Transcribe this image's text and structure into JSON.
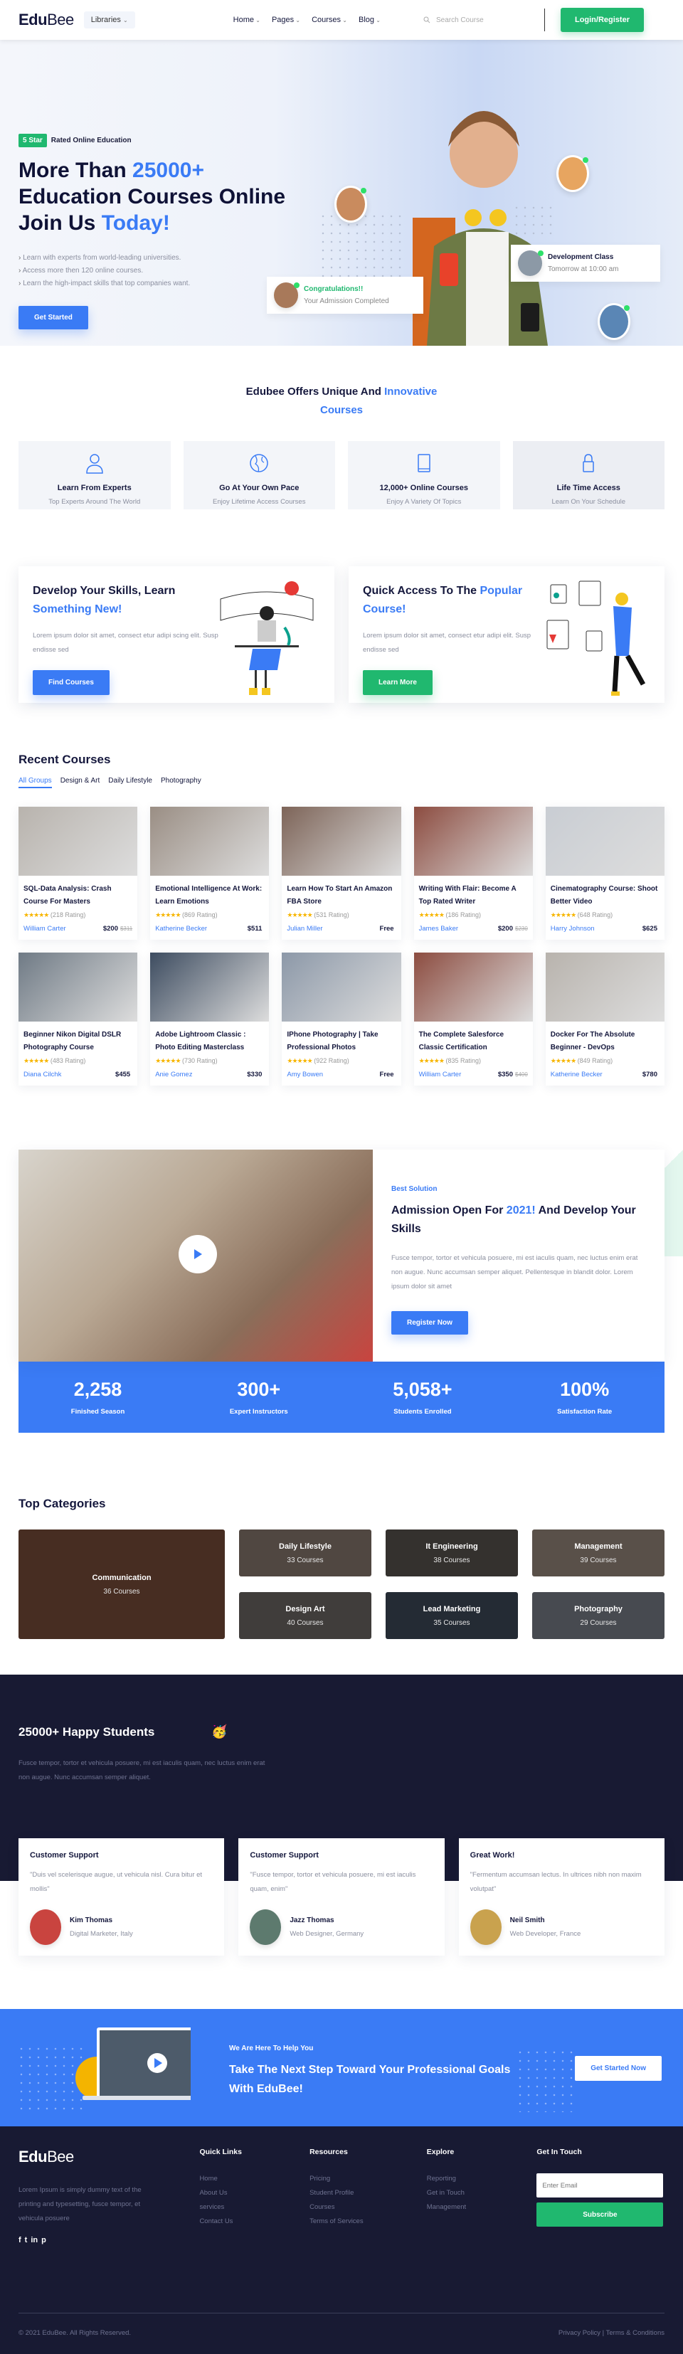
{
  "header": {
    "logo_bold": "Edu",
    "logo_light": "Bee",
    "libraries": "Libraries",
    "nav": [
      "Home",
      "Pages",
      "Courses",
      "Blog"
    ],
    "search_placeholder": "Search Course",
    "login": "Login/Register"
  },
  "hero": {
    "badge": "5 Star",
    "badge_text": "Rated Online Education",
    "title_a": "More Than ",
    "title_highlight": "25000+",
    "title_b": "Education Courses Online",
    "title_c": "Join Us ",
    "title_highlight2": "Today!",
    "bullets": [
      "Learn with experts from world-leading universities.",
      "Access more then 120 online courses.",
      "Learn the high-impact skills that top companies want."
    ],
    "cta": "Get Started",
    "notice1": {
      "title": "Congratulations!!",
      "sub": "Your Admission Completed"
    },
    "notice2": {
      "title": "Development Class",
      "sub": "Tomorrow at 10:00 am"
    }
  },
  "offers": {
    "title_a": "Edubee Offers Unique And ",
    "title_highlight": "Innovative",
    "title_b": "Courses",
    "features": [
      {
        "icon": "user-icon",
        "title": "Learn From Experts",
        "sub": "Top Experts Around The World"
      },
      {
        "icon": "globe-icon",
        "title": "Go At Your Own Pace",
        "sub": "Enjoy Lifetime Access Courses"
      },
      {
        "icon": "book-icon",
        "title": "12,000+ Online Courses",
        "sub": "Enjoy A Variety Of Topics"
      },
      {
        "icon": "lock-icon",
        "title": "Life Time Access",
        "sub": "Learn On Your Schedule"
      }
    ]
  },
  "skills": [
    {
      "title_a": "Develop Your Skills, Learn ",
      "title_highlight": "Something New!",
      "text": "Lorem ipsum dolor sit amet, consect etur adipi scing elit. Susp endisse sed",
      "button": "Find Courses",
      "color": "#3a7bf5"
    },
    {
      "title_a": "Quick Access To The ",
      "title_highlight": "Popular Course!",
      "text": "Lorem ipsum dolor sit amet, consect etur adipi elit. Susp endisse sed",
      "button": "Learn More",
      "color": "#20b86f"
    }
  ],
  "recent": {
    "title": "Recent Courses",
    "tabs": [
      "All Groups",
      "Design & Art",
      "Daily Lifestyle",
      "Photography"
    ],
    "courses": [
      {
        "title": "SQL-Data Analysis: Crash Course For Masters",
        "rating": "(218 Rating)",
        "instructor": "William Carter",
        "price": "$200",
        "old": "$311"
      },
      {
        "title": "Emotional Intelligence At Work: Learn Emotions",
        "rating": "(869 Rating)",
        "instructor": "Katherine Becker",
        "price": "$511",
        "old": ""
      },
      {
        "title": "Learn How To Start An Amazon FBA Store",
        "rating": "(531 Rating)",
        "instructor": "Julian Miller",
        "price": "Free",
        "old": ""
      },
      {
        "title": "Writing With Flair: Become A Top Rated Writer",
        "rating": "(186 Rating)",
        "instructor": "James Baker",
        "price": "$200",
        "old": "$230"
      },
      {
        "title": "Cinematography Course: Shoot Better Video",
        "rating": "(648 Rating)",
        "instructor": "Harry Johnson",
        "price": "$625",
        "old": ""
      },
      {
        "title": "Beginner Nikon Digital DSLR Photography Course",
        "rating": "(483 Rating)",
        "instructor": "Diana Cilchk",
        "price": "$455",
        "old": ""
      },
      {
        "title": "Adobe Lightroom Classic : Photo Editing Masterclass",
        "rating": "(730 Rating)",
        "instructor": "Anie Gomez",
        "price": "$330",
        "old": ""
      },
      {
        "title": "IPhone Photography | Take Professional Photos",
        "rating": "(922 Rating)",
        "instructor": "Amy Bowen",
        "price": "Free",
        "old": ""
      },
      {
        "title": "The Complete Salesforce Classic Certification",
        "rating": "(835 Rating)",
        "instructor": "William Carter",
        "price": "$350",
        "old": "$400"
      },
      {
        "title": "Docker For The Absolute Beginner - DevOps",
        "rating": "(849 Rating)",
        "instructor": "Katherine Becker",
        "price": "$780",
        "old": ""
      }
    ]
  },
  "admission": {
    "eyebrow": "Best Solution",
    "title_a": "Admission Open For ",
    "title_highlight": "2021!",
    "title_b": " And Develop Your Skills",
    "text": "Fusce tempor, tortor et vehicula posuere, mi est iaculis quam, nec luctus enim erat non augue. Nunc accumsan semper aliquet. Pellentesque in blandit dolor. Lorem ipsum dolor sit amet",
    "button": "Register Now",
    "stats": [
      {
        "value": "2,258",
        "label": "Finished Season"
      },
      {
        "value": "300+",
        "label": "Expert Instructors"
      },
      {
        "value": "5,058+",
        "label": "Students Enrolled"
      },
      {
        "value": "100%",
        "label": "Satisfaction Rate"
      }
    ]
  },
  "categories": {
    "title": "Top Categories",
    "big": {
      "name": "Communication",
      "count": "36 Courses"
    },
    "items": [
      {
        "name": "Daily Lifestyle",
        "count": "33 Courses"
      },
      {
        "name": "It Engineering",
        "count": "38 Courses"
      },
      {
        "name": "Management",
        "count": "39 Courses"
      },
      {
        "name": "Design Art",
        "count": "40 Courses"
      },
      {
        "name": "Lead Marketing",
        "count": "35 Courses"
      },
      {
        "name": "Photography",
        "count": "29 Courses"
      }
    ]
  },
  "testimonials": {
    "title": "25000+ Happy Students",
    "emoji": "🥳",
    "intro": "Fusce tempor, tortor et vehicula posuere, mi est iaculis quam, nec luctus enim erat non augue. Nunc accumsan semper aliquet.",
    "items": [
      {
        "title": "Customer Support",
        "quote": "\"Duis vel scelerisque augue, ut vehicula nisl. Cura bitur et mollis\"",
        "name": "Kim Thomas",
        "role": "Digital Marketer, Italy"
      },
      {
        "title": "Customer Support",
        "quote": "\"Fusce tempor, tortor et vehicula posuere, mi est iaculis quam, enim\"",
        "name": "Jazz Thomas",
        "role": "Web Designer, Germany"
      },
      {
        "title": "Great Work!",
        "quote": "\"Fermentum accumsan lectus. In ultrices nibh non maxim volutpat\"",
        "name": "Neil Smith",
        "role": "Web Developer, France"
      }
    ]
  },
  "cta": {
    "eyebrow": "We Are Here To Help You",
    "title": "Take The Next Step Toward Your Professional Goals With EduBee!",
    "button": "Get Started Now"
  },
  "footer": {
    "about": "Lorem Ipsum is simply dummy text of the printing and typesetting, fusce tempor, et vehicula posuere",
    "social": [
      "f",
      "t",
      "in",
      "p"
    ],
    "columns": [
      {
        "title": "Quick Links",
        "links": [
          "Home",
          "About Us",
          "services",
          "Contact Us"
        ]
      },
      {
        "title": "Resources",
        "links": [
          "Pricing",
          "Student Profile",
          "Courses",
          "Terms of Services"
        ]
      },
      {
        "title": "Explore",
        "links": [
          "Reporting",
          "Get in Touch",
          "Management"
        ]
      }
    ],
    "get_in_touch": "Get In Touch",
    "email_placeholder": "Enter Email",
    "subscribe": "Subscribe",
    "copyright": "© 2021 EduBee. All Rights Reserved.",
    "privacy": "Privacy Policy",
    "terms": "Terms & Conditions"
  }
}
